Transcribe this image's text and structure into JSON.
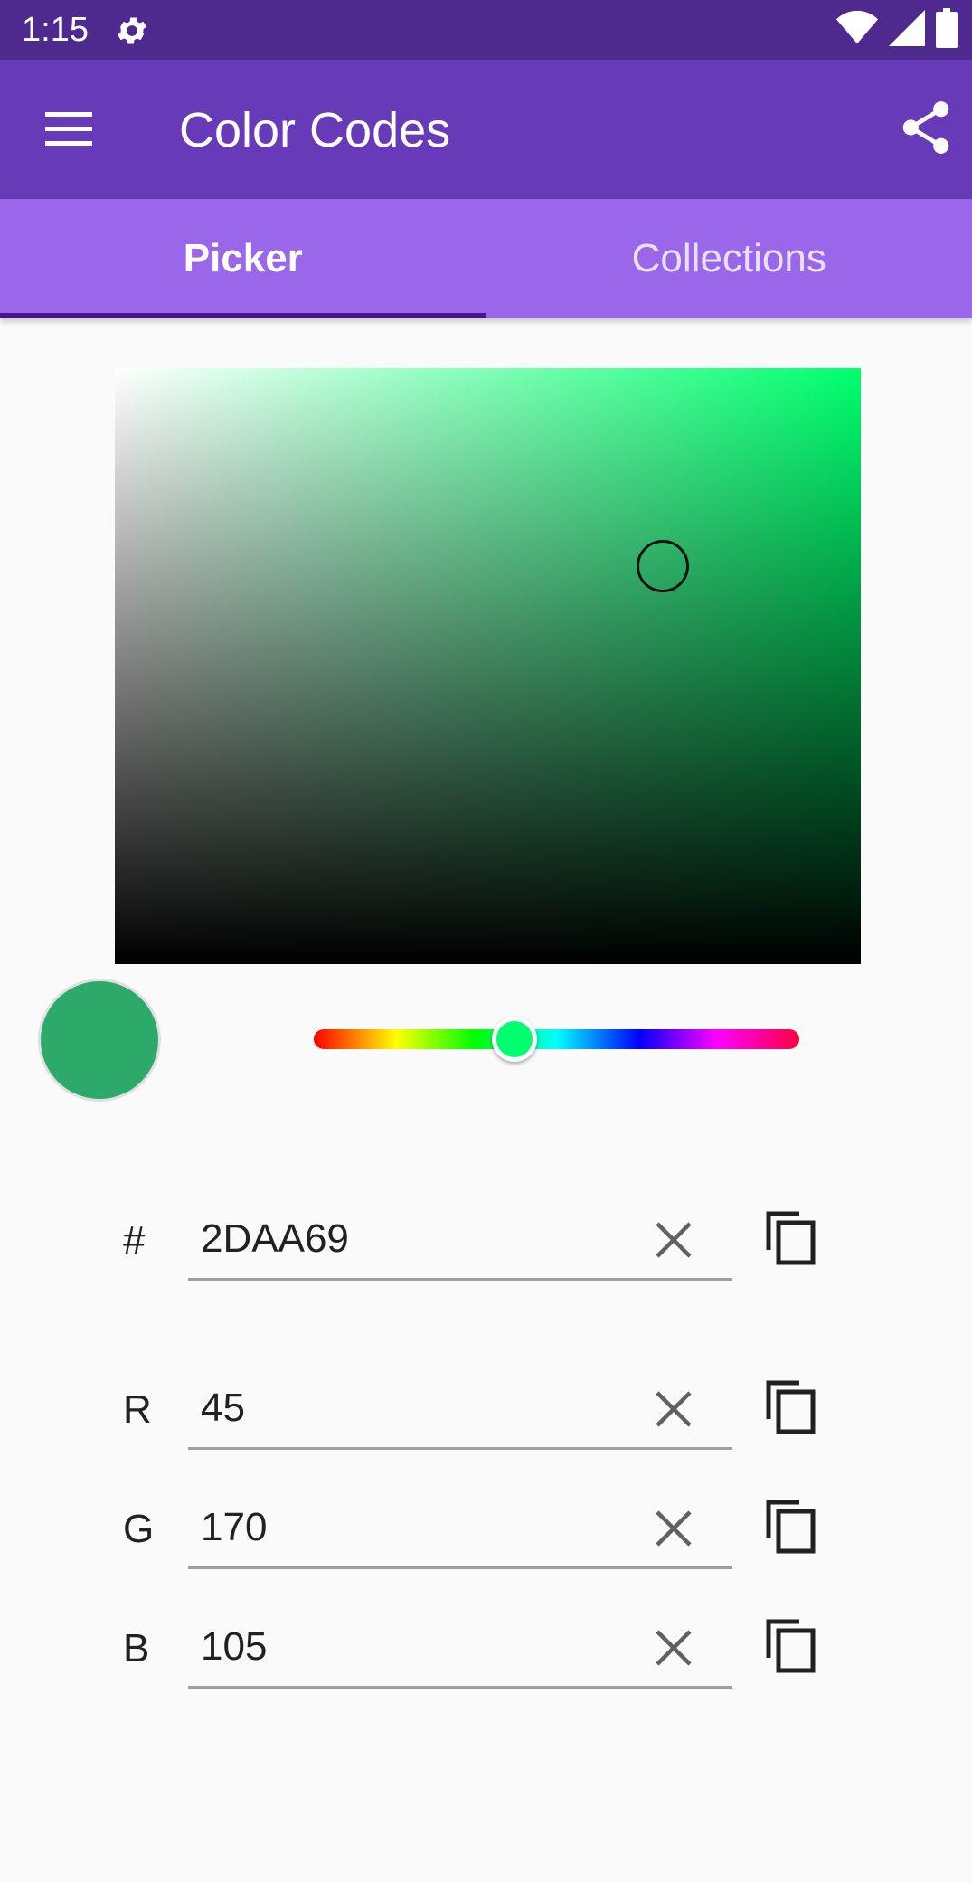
{
  "status_bar": {
    "time": "1:15",
    "icons": [
      "gear-icon",
      "wifi-icon",
      "signal-icon",
      "battery-icon"
    ]
  },
  "app_bar": {
    "title": "Color Codes",
    "menu_icon": "menu-icon",
    "share_icon": "share-icon",
    "color": "#673ab7"
  },
  "tabs": [
    {
      "label": "Picker",
      "active": true
    },
    {
      "label": "Collections",
      "active": false
    }
  ],
  "picker": {
    "hue_color": "#00ff6e",
    "hue_position": 0.413,
    "saturation": 0.735,
    "value": 0.667,
    "selected_color": "#2DAA69"
  },
  "fields": {
    "hex": {
      "label": "#",
      "value": "2DAA69"
    },
    "r": {
      "label": "R",
      "value": "45"
    },
    "g": {
      "label": "G",
      "value": "170"
    },
    "b": {
      "label": "B",
      "value": "105"
    }
  },
  "colors": {
    "status_bar": "#4e2a8e",
    "tab_bar": "#9a67ea",
    "tab_indicator": "#4a148c"
  }
}
